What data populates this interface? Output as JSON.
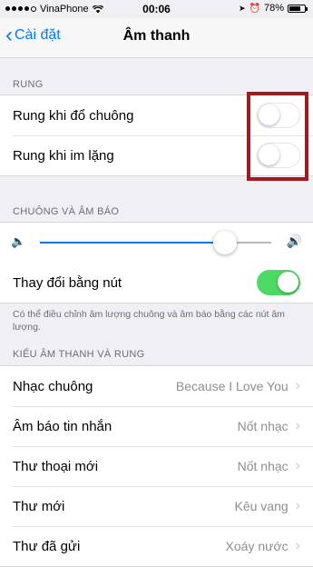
{
  "status_bar": {
    "carrier": "VinaPhone",
    "time": "00:06",
    "battery": "78%",
    "battery_level": 0.78
  },
  "nav": {
    "back_label": "Cài đặt",
    "title": "Âm thanh"
  },
  "rung": {
    "header": "RUNG",
    "items": [
      {
        "label": "Rung khi đổ chuông",
        "on": false
      },
      {
        "label": "Rung khi im lặng",
        "on": false
      }
    ]
  },
  "ringer": {
    "header": "CHUÔNG VÀ ÂM BÁO",
    "volume_level": 0.8,
    "change_with_buttons_label": "Thay đổi bằng nút",
    "change_with_buttons_on": true,
    "footnote": "Có thể điều chỉnh âm lượng chuông và âm báo bằng các nút âm lượng."
  },
  "patterns": {
    "header": "KIỂU ÂM THANH VÀ RUNG",
    "items": [
      {
        "label": "Nhạc chuông",
        "value": "Because I Love You"
      },
      {
        "label": "Âm báo tin nhắn",
        "value": "Nốt nhạc"
      },
      {
        "label": "Thư thoại mới",
        "value": "Nốt nhạc"
      },
      {
        "label": "Thư mới",
        "value": "Kêu vang"
      },
      {
        "label": "Thư đã gửi",
        "value": "Xoáy nước"
      }
    ]
  },
  "colors": {
    "accent": "#007aff",
    "toggle_on": "#4cd964",
    "highlight": "#a31821"
  }
}
